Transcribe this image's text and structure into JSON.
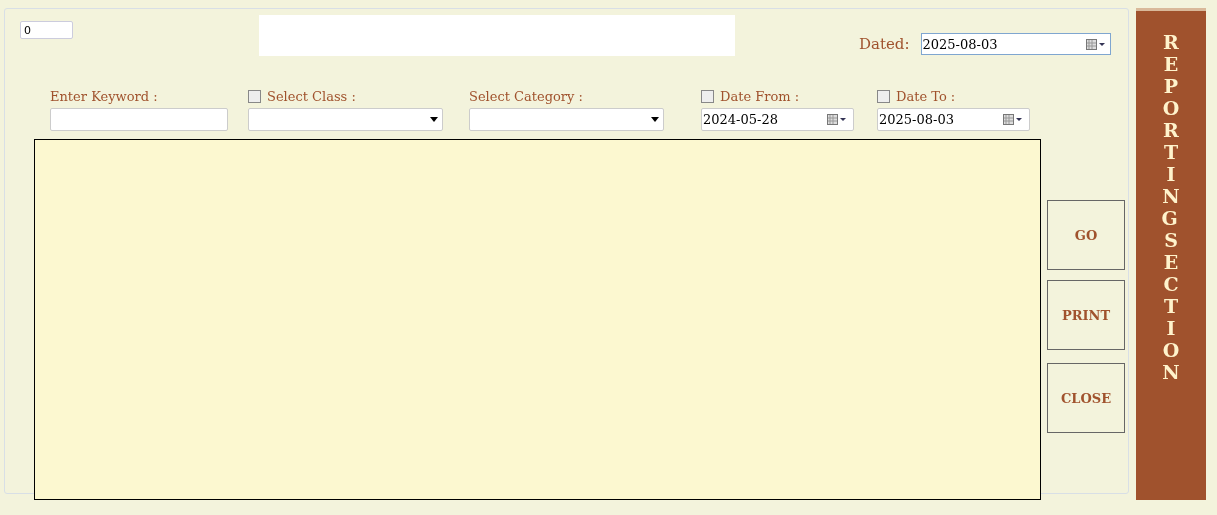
{
  "counter_field": {
    "value": "0"
  },
  "dated": {
    "label": "Dated:",
    "value": "2025-08-03"
  },
  "filters": [
    {
      "kind": "text",
      "label": "Enter Keyword :"
    },
    {
      "kind": "select",
      "label": "Select Class :",
      "checked": false
    },
    {
      "kind": "select",
      "label": "Select Category :"
    },
    {
      "kind": "date",
      "label": "Date From :",
      "checked": false,
      "value": "2024-05-28"
    },
    {
      "kind": "date",
      "label": "Date To :",
      "checked": false,
      "value": "2025-08-03"
    }
  ],
  "buttons": [
    "GO",
    "PRINT",
    "CLOSE"
  ],
  "banner": {
    "title": "REPORTING SECTION"
  }
}
